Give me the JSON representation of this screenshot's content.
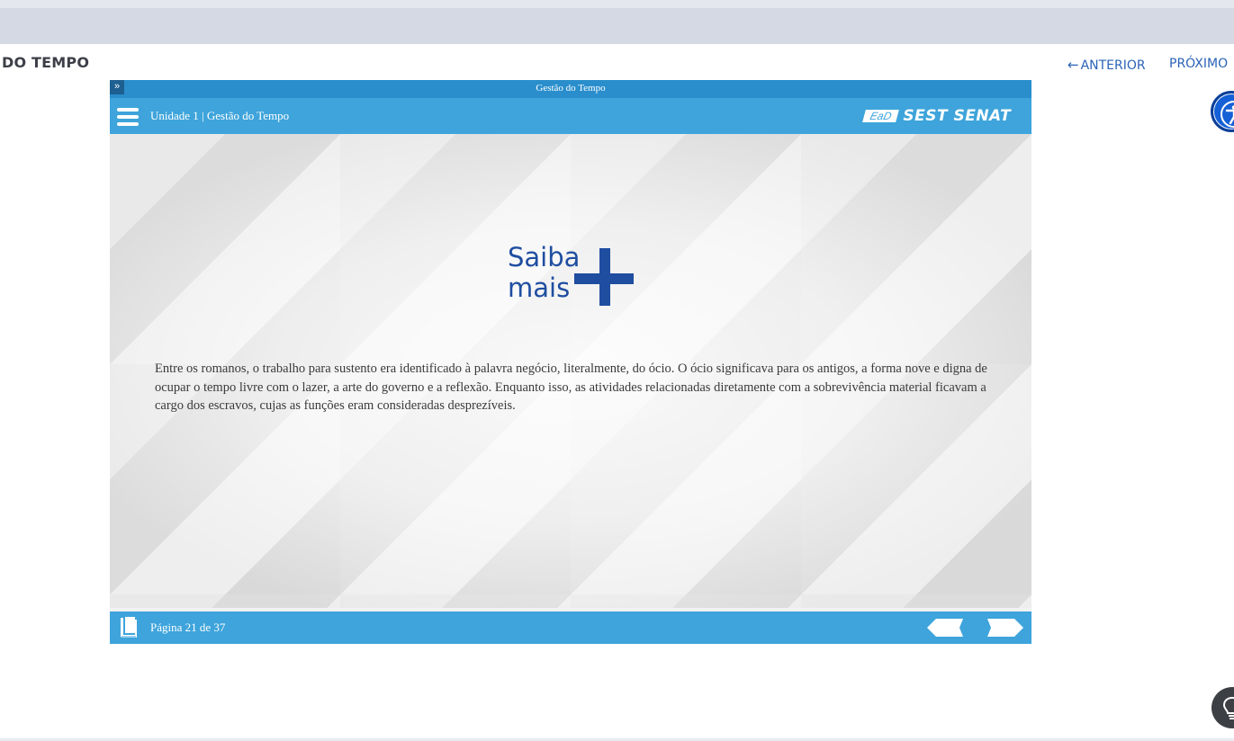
{
  "course": {
    "title": "DO TEMPO",
    "prev_label": "ANTERIOR",
    "prev_arrow": "←",
    "next_label": "PRÓXIMO"
  },
  "player": {
    "window_title": "Gestão do Tempo",
    "expand_glyph": "»",
    "unit_title": "Unidade 1 | Gestão do Tempo",
    "brand": {
      "ead": "EaD",
      "name": "SEST SENAT"
    },
    "content": {
      "heading_line1": "Saiba",
      "heading_line2": "mais",
      "body": "Entre os romanos, o trabalho para sustento era identificado à palavra negócio, literalmente, do ócio. O ócio significava para os antigos, a forma nove e digna de ocupar o tempo livre com o lazer, a arte do governo e a reflexão. Enquanto isso, as atividades relacionadas diretamente com a sobrevivência material ficavam a cargo dos escravos, cujas as funções eram consideradas desprezíveis."
    },
    "footer": {
      "page_info": "Página 21 de 37",
      "page_current": 21,
      "page_total": 37
    }
  },
  "colors": {
    "header_blue": "#3ea4db",
    "title_blue": "#2a8ecc",
    "heading_blue": "#1f4ea1",
    "link_blue": "#2b63b8"
  },
  "icons": [
    "menu-icon",
    "book-icon",
    "prev-arrow-icon",
    "next-arrow-icon",
    "accessibility-icon",
    "lightbulb-icon",
    "expand-icon"
  ]
}
